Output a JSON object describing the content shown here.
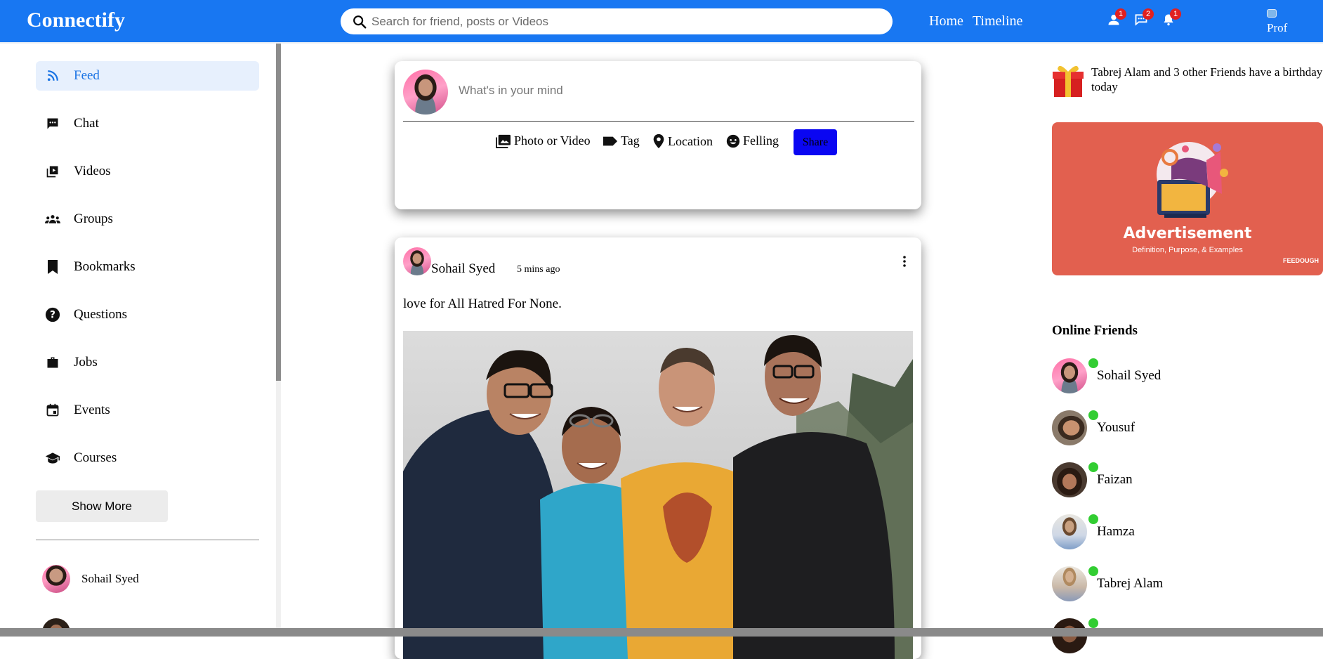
{
  "header": {
    "logo": "Connectify",
    "search_placeholder": "Search for friend, posts or Videos",
    "links": [
      "Home",
      "Timeline"
    ],
    "badges": {
      "friends": "1",
      "messages": "2",
      "notifications": "1"
    },
    "profile_alt": "Prof"
  },
  "sidebar": {
    "items": [
      {
        "label": "Feed",
        "icon": "rss-icon"
      },
      {
        "label": "Chat",
        "icon": "chat-icon"
      },
      {
        "label": "Videos",
        "icon": "video-library-icon"
      },
      {
        "label": "Groups",
        "icon": "groups-icon"
      },
      {
        "label": "Bookmarks",
        "icon": "bookmark-icon"
      },
      {
        "label": "Questions",
        "icon": "help-icon"
      },
      {
        "label": "Jobs",
        "icon": "work-icon"
      },
      {
        "label": "Events",
        "icon": "event-icon"
      },
      {
        "label": "Courses",
        "icon": "school-icon"
      }
    ],
    "show_more": "Show More",
    "friends": [
      "Sohail Syed"
    ]
  },
  "share": {
    "placeholder": "What's in your mind",
    "options": [
      "Photo or Video",
      "Tag",
      "Location",
      "Felling"
    ],
    "button": "Share"
  },
  "post": {
    "author": "Sohail Syed",
    "time": "5 mins ago",
    "text": "love for All Hatred For None."
  },
  "rightbar": {
    "birthday": "Tabrej Alam and 3 other Friends have a birthday today",
    "ad": {
      "title": "Advertisement",
      "subtitle": "Definition, Purpose, & Examples",
      "brand": "FEEDOUGH"
    },
    "online_title": "Online Friends",
    "online_friends": [
      "Sohail Syed",
      "Yousuf",
      "Faizan",
      "Hamza",
      "Tabrej Alam"
    ]
  },
  "colors": {
    "primary": "#1877f2",
    "share_button": "#0a06f2",
    "online_dot": "#32cd32",
    "ad_bg": "#e2604f"
  }
}
